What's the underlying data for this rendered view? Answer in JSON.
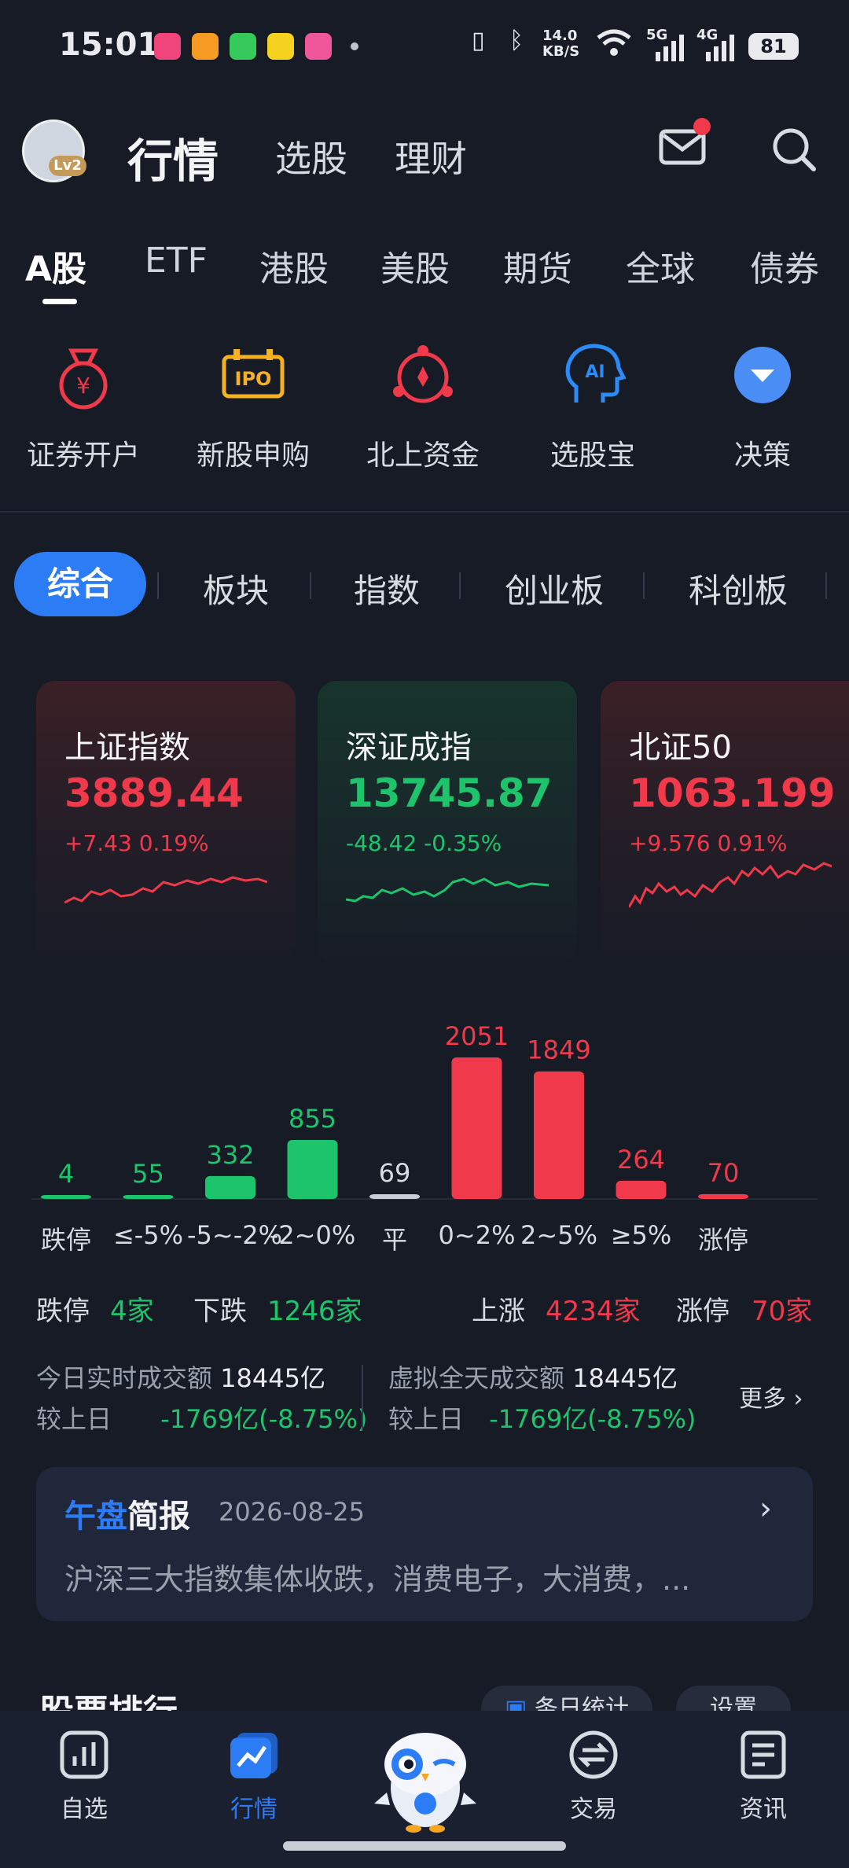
{
  "status_bar": {
    "time": "15:01",
    "net_speed": "14.0\nKB/S",
    "net5g": "5G",
    "net4g": "4G",
    "battery": "81"
  },
  "header": {
    "level": "Lv2",
    "title": "行情",
    "nav": [
      "选股",
      "理财"
    ]
  },
  "market_tabs": [
    "A股",
    "ETF",
    "港股",
    "美股",
    "期货",
    "全球",
    "债券"
  ],
  "quick_actions": [
    "证券开户",
    "新股申购",
    "北上资金",
    "选股宝",
    "决策"
  ],
  "segments": [
    "综合",
    "板块",
    "指数",
    "创业板",
    "科创板"
  ],
  "indices": [
    {
      "name": "上证指数",
      "value": "3889.44",
      "change": "+7.43  0.19%"
    },
    {
      "name": "深证成指",
      "value": "13745.87",
      "change": "-48.42  -0.35%"
    },
    {
      "name": "北证50",
      "value": "1063.199",
      "change": "+9.576  0.91%"
    }
  ],
  "colors": {
    "up": "#f0394a",
    "down": "#1ec46c",
    "flat": "#c8ccd4",
    "accent": "#2c7cf6"
  },
  "chart_data": {
    "type": "bar",
    "categories": [
      "跌停",
      "≤-5%",
      "-5~-2%",
      "-2~0%",
      "平",
      "0~2%",
      "2~5%",
      "≥5%",
      "涨停"
    ],
    "values": [
      4,
      55,
      332,
      855,
      69,
      2051,
      1849,
      264,
      70
    ],
    "labels": [
      "4",
      "55",
      "332",
      "855",
      "69",
      "2051",
      "1849",
      "264",
      "70"
    ]
  },
  "summary": {
    "down_limit_label": "跌停",
    "down_limit_value": "4家",
    "down_label": "下跌",
    "down_value": "1246家",
    "up_label": "上涨",
    "up_value": "4234家",
    "up_limit_label": "涨停",
    "up_limit_value": "70家"
  },
  "turnover": {
    "today_label": "今日实时成交额",
    "today_value": "18445亿",
    "today_cmp_label": "较上日",
    "today_cmp_value": "-1769亿(-8.75%)",
    "virtual_label": "虚拟全天成交额",
    "virtual_value": "18445亿",
    "virtual_cmp_label": "较上日",
    "virtual_cmp_value": "-1769亿(-8.75%)",
    "more": "更多 ›"
  },
  "brief": {
    "title_accent": "午盘",
    "title": "简报",
    "date": "2026-08-25",
    "text": "沪深三大指数集体收跌，消费电子，大消费，..."
  },
  "ranking": {
    "title": "股票排行",
    "pill1": "条日统计",
    "pill2": "设置"
  },
  "bottom_nav": [
    "自选",
    "行情",
    "交易",
    "资讯"
  ]
}
